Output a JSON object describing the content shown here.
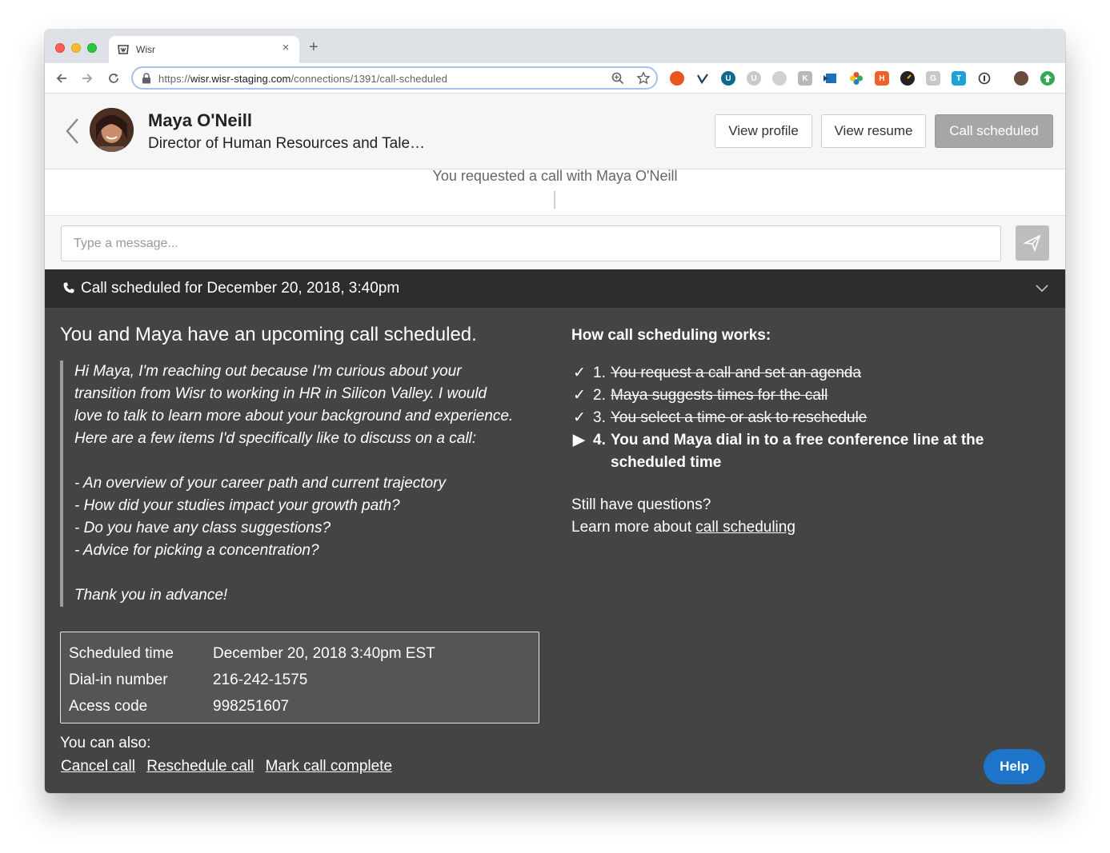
{
  "browser": {
    "tab_title": "Wisr",
    "tab_close": "×",
    "new_tab": "+",
    "url_prefix": "https://",
    "url_host": "wisr.wisr-staging.com",
    "url_path": "/connections/1391/call-scheduled",
    "extensions": [
      {
        "icon": "duckduckgo-icon",
        "color": "#e8571f"
      },
      {
        "icon": "vimeo-icon",
        "color": "#ffffff"
      },
      {
        "icon": "ublock-icon",
        "color": "#0d6a8a"
      },
      {
        "icon": "extension-u-icon",
        "color": "#c9c9c9"
      },
      {
        "icon": "extension-circle-icon",
        "color": "#d0d0d0"
      },
      {
        "icon": "extension-k-icon",
        "color": "#b8b8b8"
      },
      {
        "icon": "extension-flag-icon",
        "color": "#1c6fb8"
      },
      {
        "icon": "colorwheel-icon",
        "color": "#e84b3c"
      },
      {
        "icon": "hubspot-icon",
        "color": "#f0622c"
      },
      {
        "icon": "speedometer-icon",
        "color": "#222222"
      },
      {
        "icon": "extension-g-icon",
        "color": "#c8c8c8"
      },
      {
        "icon": "trello-icon",
        "color": "#1ea0d8"
      },
      {
        "icon": "info-icon",
        "color": "#333333"
      }
    ]
  },
  "header": {
    "name": "Maya O'Neill",
    "job_title": "Director of Human Resources and Tale…",
    "buttons": {
      "view_profile": "View profile",
      "view_resume": "View resume",
      "call_scheduled": "Call scheduled"
    }
  },
  "thread": {
    "request_text": "You requested a call with Maya O'Neill"
  },
  "compose": {
    "placeholder": "Type a message..."
  },
  "call_panel": {
    "bar_text": "Call scheduled for December 20, 2018, 3:40pm",
    "heading": "You and Maya have an upcoming call scheduled.",
    "message": "Hi Maya, I'm reaching out because I'm curious about your\ntransition from Wisr to working in HR in Silicon Valley. I would\nlove to talk to learn more about your background and experience.\nHere are a few items I'd specifically like to discuss on a call:\n\n- An overview of your career path and current trajectory\n- How did your studies impact your growth path?\n- Do you have any class suggestions?\n- Advice for picking a concentration?\n\nThank you in advance!",
    "details": [
      {
        "label": "Scheduled time",
        "value": "December 20, 2018 3:40pm EST"
      },
      {
        "label": "Dial-in number",
        "value": "216-242-1575"
      },
      {
        "label": "Acess code",
        "value": "998251607"
      }
    ],
    "also_label": "You can also:",
    "actions": {
      "cancel": "Cancel call",
      "reschedule": "Reschedule call",
      "complete": "Mark call complete"
    },
    "how_title": "How call scheduling works:",
    "steps": [
      {
        "mark": "✓",
        "num": "1.",
        "text": "You request a call and set an agenda",
        "state": "done"
      },
      {
        "mark": "✓",
        "num": "2.",
        "text": "Maya suggests times for the call",
        "state": "done"
      },
      {
        "mark": "✓",
        "num": "3.",
        "text": "You select a time or ask to reschedule",
        "state": "done"
      },
      {
        "mark": "▶",
        "num": "4.",
        "text": "You and Maya dial in to a free conference line at the scheduled time",
        "state": "current"
      }
    ],
    "questions_line": "Still have questions?",
    "learn_more_prefix": "Learn more about",
    "learn_more_link": "call scheduling",
    "help_label": "Help"
  },
  "colors": {
    "panel_bg": "#444444",
    "bar_bg": "#2d2d2d",
    "help_blue": "#1e74c8",
    "scheduled_btn": "#a6a6a6"
  }
}
